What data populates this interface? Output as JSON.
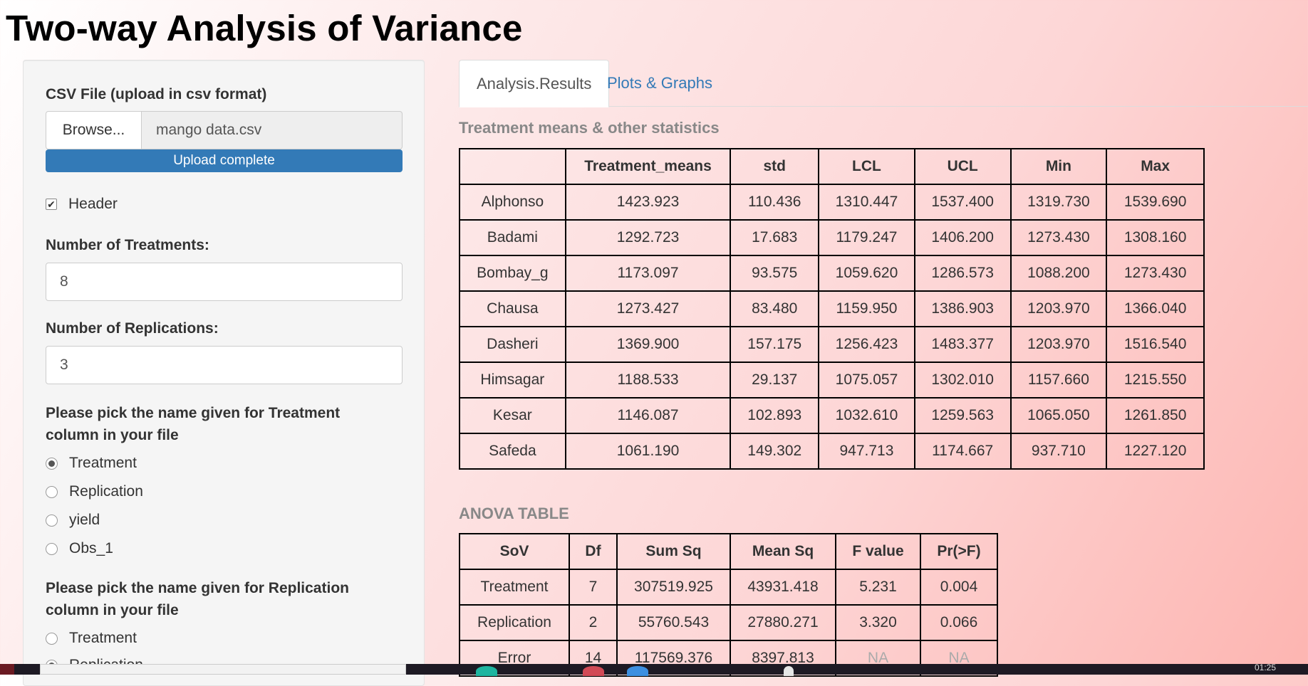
{
  "page_title": "Two-way Analysis of Variance",
  "sidebar": {
    "file_label": "CSV File (upload in csv format)",
    "browse_label": "Browse...",
    "file_name": "mango data.csv",
    "upload_status": "Upload complete",
    "upload_progress": 1.0,
    "header_label": "Header",
    "header_checked": true,
    "treatments_label": "Number of Treatments:",
    "treatments_value": "8",
    "replications_label": "Number of Replications:",
    "replications_value": "3",
    "treatment_col_label": "Please pick the name given for Treatment column in your file",
    "treatment_col_options": [
      "Treatment",
      "Replication",
      "yield",
      "Obs_1"
    ],
    "treatment_col_selected": "Treatment",
    "replication_col_label": "Please pick the name given for Replication column in your file",
    "replication_col_options": [
      "Treatment",
      "Replication"
    ],
    "replication_col_selected": "Replication"
  },
  "tabs": [
    {
      "label": "Analysis.Results",
      "active": true
    },
    {
      "label": "Plots & Graphs",
      "active": false
    }
  ],
  "means_section": {
    "heading": "Treatment means & other statistics",
    "columns": [
      "",
      "Treatment_means",
      "std",
      "LCL",
      "UCL",
      "Min",
      "Max"
    ],
    "rows": [
      [
        "Alphonso",
        "1423.923",
        "110.436",
        "1310.447",
        "1537.400",
        "1319.730",
        "1539.690"
      ],
      [
        "Badami",
        "1292.723",
        "17.683",
        "1179.247",
        "1406.200",
        "1273.430",
        "1308.160"
      ],
      [
        "Bombay_g",
        "1173.097",
        "93.575",
        "1059.620",
        "1286.573",
        "1088.200",
        "1273.430"
      ],
      [
        "Chausa",
        "1273.427",
        "83.480",
        "1159.950",
        "1386.903",
        "1203.970",
        "1366.040"
      ],
      [
        "Dasheri",
        "1369.900",
        "157.175",
        "1256.423",
        "1483.377",
        "1203.970",
        "1516.540"
      ],
      [
        "Himsagar",
        "1188.533",
        "29.137",
        "1075.057",
        "1302.010",
        "1157.660",
        "1215.550"
      ],
      [
        "Kesar",
        "1146.087",
        "102.893",
        "1032.610",
        "1259.563",
        "1065.050",
        "1261.850"
      ],
      [
        "Safeda",
        "1061.190",
        "149.302",
        "947.713",
        "1174.667",
        "937.710",
        "1227.120"
      ]
    ]
  },
  "anova_section": {
    "heading": "ANOVA TABLE",
    "columns": [
      "SoV",
      "Df",
      "Sum Sq",
      "Mean Sq",
      "F value",
      "Pr(>F)"
    ],
    "rows": [
      [
        "Treatment",
        "7",
        "307519.925",
        "43931.418",
        "5.231",
        "0.004"
      ],
      [
        "Replication",
        "2",
        "55760.543",
        "27880.271",
        "3.320",
        "0.066"
      ],
      [
        "Error",
        "14",
        "117569.376",
        "8397.813",
        "NA",
        "NA"
      ]
    ]
  },
  "taskbar": {
    "clock": "01:25"
  },
  "colors": {
    "accent": "#337ab7",
    "heading_gray": "#888888",
    "taskbar": "#1e1a24"
  }
}
